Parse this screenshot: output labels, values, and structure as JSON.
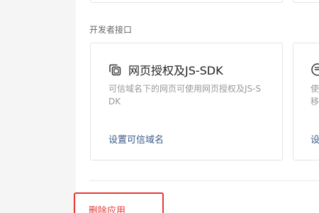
{
  "section": {
    "title": "开发者接口"
  },
  "cards": [
    {
      "icon": "copy-squares-icon",
      "title": "网页授权及JS-SDK",
      "description": "可信域名下的网页可使用网页授权及JS-SDK",
      "link": "设置可信域名"
    },
    {
      "icon": "minus-circle-icon",
      "description_line1": "使",
      "description_line2": "移",
      "link": "设"
    }
  ],
  "danger": {
    "delete_label": "删除应用",
    "highlight_color": "#e53935"
  },
  "colors": {
    "link": "#3c5a8a",
    "muted": "#999999",
    "border": "#e4e4e4"
  }
}
